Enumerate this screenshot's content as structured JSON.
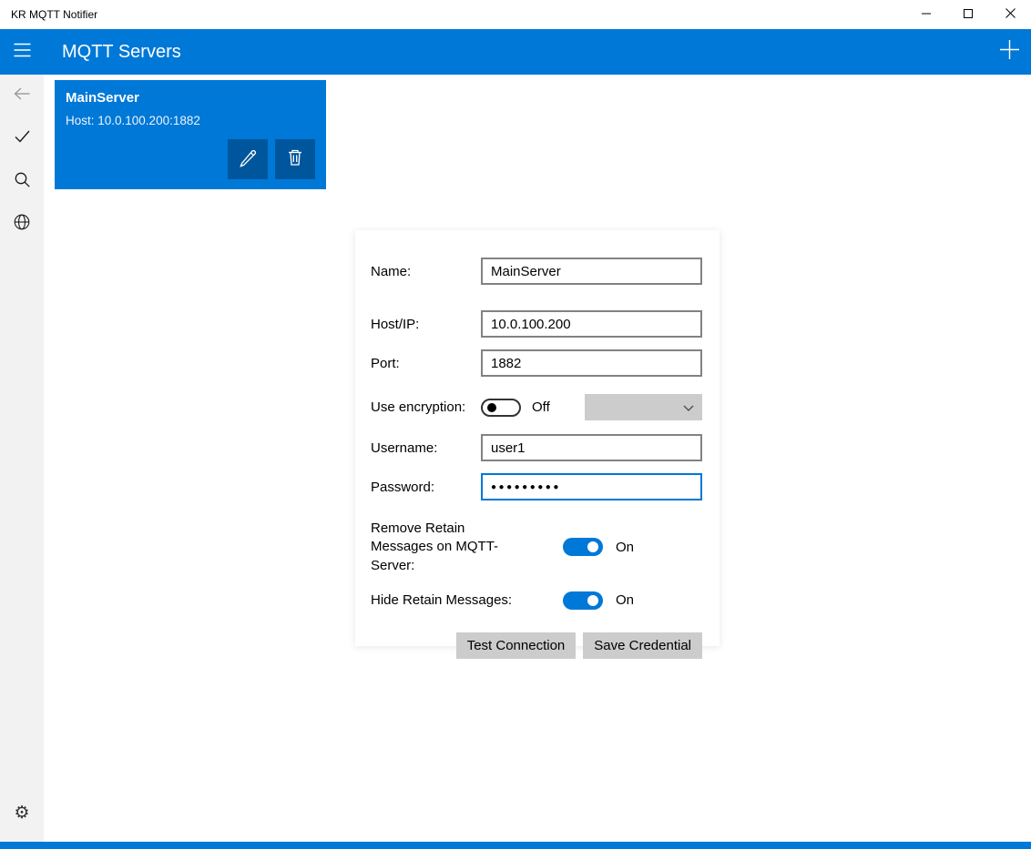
{
  "window": {
    "title": "KR MQTT Notifier"
  },
  "header": {
    "title": "MQTT Servers"
  },
  "server_card": {
    "name": "MainServer",
    "host": "Host: 10.0.100.200:1882"
  },
  "form": {
    "name_label": "Name:",
    "name_value": "MainServer",
    "host_label": "Host/IP:",
    "host_value": "10.0.100.200",
    "port_label": "Port:",
    "port_value": "1882",
    "encryption_label": "Use encryption:",
    "encryption_state": "Off",
    "username_label": "Username:",
    "username_value": "user1",
    "password_label": "Password:",
    "password_value": "●●●●●●●●●",
    "remove_retain_label": "Remove Retain Messages on MQTT-Server:",
    "remove_retain_state": "On",
    "hide_retain_label": "Hide Retain Messages:",
    "hide_retain_state": "On",
    "test_button_label": "Test Connection",
    "save_button_label": "Save Credential"
  },
  "icons": {
    "gear_glyph": "⚙"
  },
  "colors": {
    "accent": "#0078d7",
    "accent_dark": "#00569c",
    "sidebar_bg": "#f2f2f2",
    "button_bg": "#cccccc"
  }
}
